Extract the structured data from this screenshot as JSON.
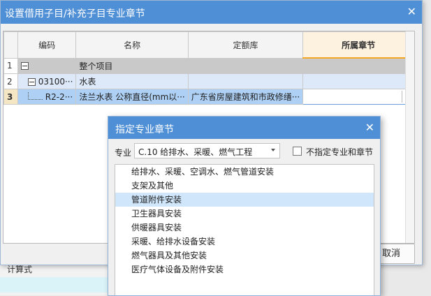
{
  "background": {
    "label": "计算式"
  },
  "main_dialog": {
    "title": "设置借用子目/补充子目专业章节",
    "columns": [
      "编码",
      "名称",
      "定额库",
      "所属章节"
    ],
    "rows": [
      {
        "num": "1",
        "code": "",
        "name": "整个项目",
        "lib": "",
        "chapter": ""
      },
      {
        "num": "2",
        "code": "03100···",
        "name": "水表",
        "lib": "",
        "chapter": ""
      },
      {
        "num": "3",
        "code": "R2-2···",
        "name": "法兰水表 公称直径(mm以···",
        "lib": "广东省房屋建筑和市政修缮···",
        "chapter": ""
      }
    ],
    "cancel_label": "取消",
    "colors": {
      "title_bar": "#4f8fd6",
      "active_header": "#fdf1df",
      "selected_row": "#aed0f4"
    }
  },
  "chapter_dialog": {
    "title": "指定专业章节",
    "specialty_label": "专业",
    "specialty_value": "C.10 给排水、采暖、燃气工程",
    "unspecified_checkbox_label": "不指定专业和章节",
    "unspecified_checked": false,
    "items": [
      "给排水、采暖、空调水、燃气管道安装",
      "支架及其他",
      "管道附件安装",
      "卫生器具安装",
      "供暖器具安装",
      "采暖、给排水设备安装",
      "燃气器具及其他安装",
      "医疗气体设备及附件安装"
    ],
    "selected_index": 2
  },
  "icons": {
    "close": "close-icon",
    "collapse": "collapse-icon",
    "dropdown": "chevron-down-icon"
  }
}
